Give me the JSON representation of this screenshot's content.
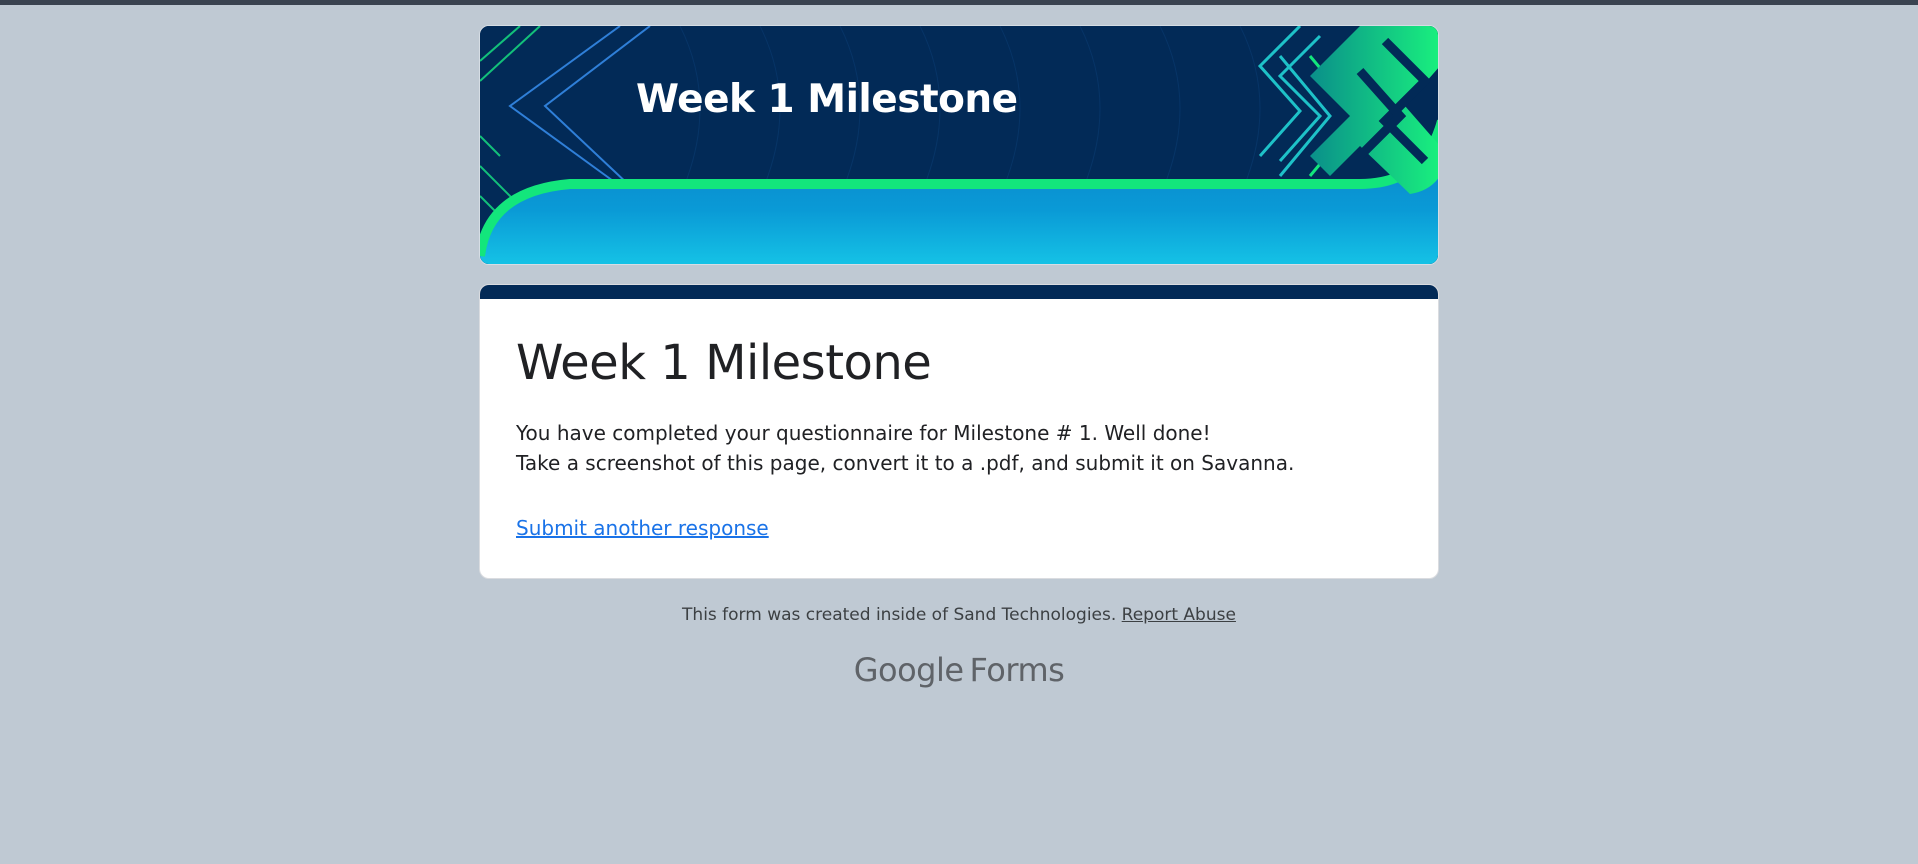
{
  "banner": {
    "title": "Week 1 Milestone"
  },
  "card": {
    "title": "Week 1 Milestone",
    "message_line1": "You have completed your questionnaire for Milestone # 1. Well done!",
    "message_line2": "Take a screenshot of this page, convert it to a .pdf, and submit it on Savanna.",
    "link_label": "Submit another response"
  },
  "footer": {
    "created_text": "This form was created inside of Sand Technologies. ",
    "report_label": "Report Abuse",
    "brand_google": "Google",
    "brand_product": "Forms"
  },
  "colors": {
    "page_background": "#bfc9d3",
    "banner_navy": "#022a57",
    "accent_green": "#13e67c",
    "banner_blue": "#0a8fd0",
    "link_blue": "#1a73e8"
  }
}
